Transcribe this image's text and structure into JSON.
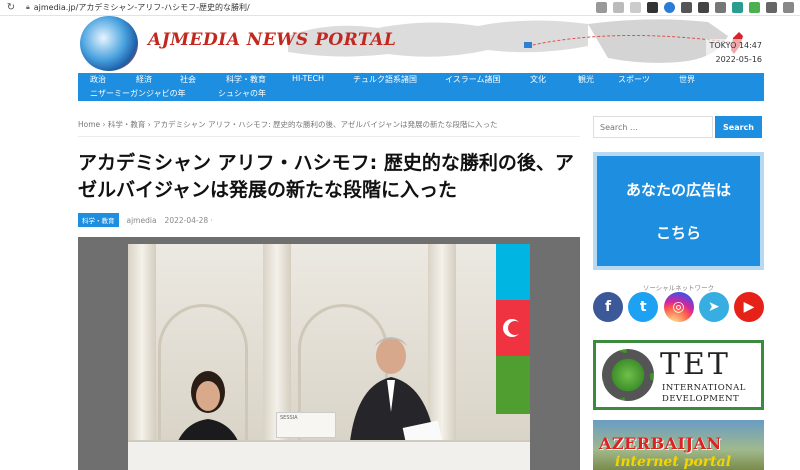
{
  "browser": {
    "url": "ajmedia.jp/アカデミシャン-アリフ-ハシモフ-歴史的な勝利/"
  },
  "header": {
    "logo_text": "AJMEDIA NEWS PORTAL",
    "clock_city": "TOKYO 14:47",
    "clock_date": "2022-05-16"
  },
  "nav": {
    "row1": [
      "政治",
      "経済",
      "社会",
      "科学・教育",
      "HI-TECH",
      "チュルク語系諸国",
      "イスラーム諸国",
      "文化",
      "観光",
      "スポーツ",
      "世界"
    ],
    "row2": [
      "ニザーミーガンジャビの年",
      "シュシャの年"
    ]
  },
  "breadcrumb": "Home › 科学・教育 › アカデミシャン アリフ・ハシモフ: 歴史的な勝利の後、アゼルバイジャンは発展の新たな段階に入った",
  "article": {
    "title": "アカデミシャン アリフ・ハシモフ: 歴史的な勝利の後、アゼルバイジャンは発展の新たな段階に入った",
    "category": "科学・教育",
    "author": "ajmedia",
    "date": "2022-04-28"
  },
  "photo": {
    "sign_text": "SESSIA"
  },
  "sidebar": {
    "search_placeholder": "Search …",
    "search_button": "Search",
    "ad_line1": "あなたの広告は",
    "ad_line2": "こちら",
    "social_label": "ソーシャルネットワーク",
    "tet_letters": "TET",
    "tet_line1": "INTERNATIONAL",
    "tet_line2": "DEVELOPMENT",
    "azer_title": "AZERBAIJAN",
    "azer_sub": "internet portal"
  },
  "colors": {
    "accent": "#1e8fe0",
    "logo_red": "#c2281f"
  }
}
